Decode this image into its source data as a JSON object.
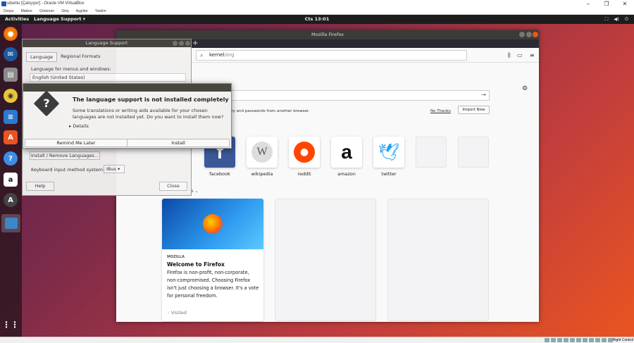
{
  "host": {
    "title": "ubuntu [Çalışıyor] - Oracle VM VirtualBox",
    "menu": [
      "Dosya",
      "Makine",
      "Görünüm",
      "Giriş",
      "Aygıtlar",
      "Yardım"
    ],
    "status_right": "Right Control"
  },
  "topbar": {
    "activities": "Activities",
    "app_menu": "Language Support ▾",
    "clock": "Cts 13:01"
  },
  "firefox": {
    "title": "Mozilla Firefox",
    "url_typed": "kernel",
    "url_hint": "/org",
    "import_text": "history and passwords from another browser.",
    "no_thanks": "No Thanks",
    "import_now": "Import Now",
    "top_sites": [
      {
        "label": "facebook"
      },
      {
        "label": "wikipedia"
      },
      {
        "label": "reddit"
      },
      {
        "label": "amazon"
      },
      {
        "label": "twitter"
      }
    ],
    "highlights_toggle": "rs ⌄",
    "card": {
      "source": "MOZILLA",
      "title": "Welcome to Firefox",
      "description": "Firefox is non-profit, non-corporate, non-compromised. Choosing Firefox isn't just choosing a browser. It's a vote for personal freedom.",
      "visited": "Visited"
    }
  },
  "language_support": {
    "title": "Language Support",
    "tabs": [
      "Language",
      "Regional Formats"
    ],
    "menus_label": "Language for menus and windows:",
    "first_language": "English (United States)",
    "install_remove": "Install / Remove Languages...",
    "keyboard_label": "Keyboard input method system:",
    "keyboard_value": "IBus",
    "help": "Help",
    "close": "Close"
  },
  "dialog": {
    "title": "The language support is not installed completely",
    "message": "Some translations or writing aids available for your chosen languages are not installed yet. Do you want to install them now?",
    "details": "Details",
    "remind_later": "Remind Me Later",
    "install": "Install"
  },
  "colors": {
    "ubuntu_orange": "#e95420",
    "ubuntu_aubergine": "#5a2149",
    "titlebar": "#3c3b37"
  }
}
